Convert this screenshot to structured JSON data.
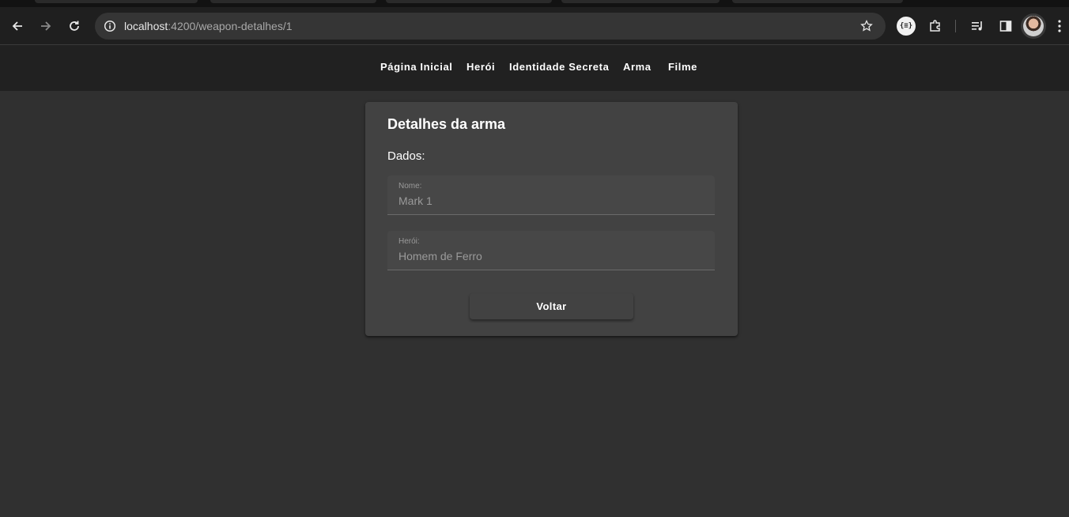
{
  "browser": {
    "url_host": "localhost",
    "url_path": ":4200/weapon-detalhes/1",
    "extension_badge": "{≡}",
    "icons": {
      "back": "arrow-left-icon",
      "forward": "arrow-right-icon",
      "reload": "reload-icon",
      "site_info": "info-circle-icon",
      "bookmark": "star-icon",
      "extensions": "puzzle-icon",
      "media": "media-queue-icon",
      "side_panel": "side-panel-icon",
      "menu": "kebab-menu-icon"
    }
  },
  "nav": {
    "items": [
      {
        "label": "Página Inicial"
      },
      {
        "label": "Herói"
      },
      {
        "label": "Identidade Secreta"
      },
      {
        "label": "Arma"
      },
      {
        "label": "Filme"
      }
    ]
  },
  "card": {
    "title": "Detalhes da arma",
    "section_label": "Dados:",
    "fields": [
      {
        "label": "Nome:",
        "value": "Mark 1"
      },
      {
        "label": "Herói:",
        "value": "Homem de Ferro"
      }
    ],
    "back_button": "Voltar"
  },
  "colors": {
    "page_background": "#303030",
    "nav_background": "#212121",
    "card_background": "#424242",
    "field_text": "#9a9a9a"
  }
}
